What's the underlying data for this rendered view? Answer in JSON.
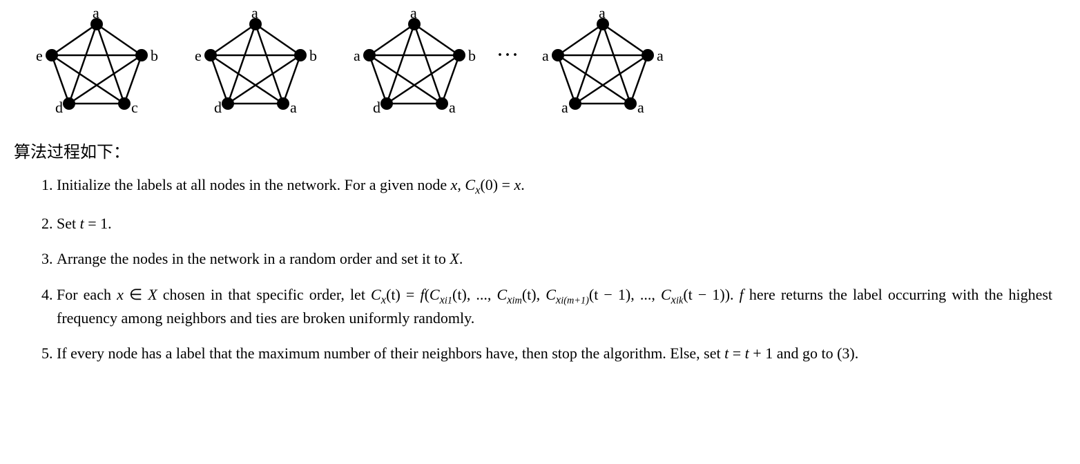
{
  "graphs": [
    {
      "labels": {
        "top": "a",
        "right": "b",
        "br": "c",
        "bl": "d",
        "left": "e"
      }
    },
    {
      "labels": {
        "top": "a",
        "right": "b",
        "br": "a",
        "bl": "d",
        "left": "e"
      }
    },
    {
      "labels": {
        "top": "a",
        "right": "b",
        "br": "a",
        "bl": "d",
        "left": "a"
      }
    },
    {
      "labels": {
        "top": "a",
        "right": "a",
        "br": "a",
        "bl": "a",
        "left": "a"
      }
    }
  ],
  "ellipsis": "···",
  "algo_heading": "算法过程如下：",
  "steps": {
    "s1": {
      "p1": "Initialize the labels at all nodes in the network. For a given node ",
      "x": "x",
      "p2": ", ",
      "formula_pre": "C",
      "formula_sub": "x",
      "formula_args": "(0) = ",
      "formula_rhs": "x",
      "p3": "."
    },
    "s2": {
      "p1": "Set ",
      "t": "t",
      "eq": " = 1."
    },
    "s3": {
      "p1": "Arrange the nodes in the network in a random order and set it to ",
      "X": "X",
      "p2": "."
    },
    "s4": {
      "p1": "For each ",
      "x": "x",
      "in": " ∈ ",
      "X": "X",
      "p2": " chosen in that specific order, let ",
      "Cx": "C",
      "Cx_sub": "x",
      "Cx_t": "(t)",
      "eq": " = ",
      "f": "f",
      "open": "(",
      "close": ")",
      "C1": "C",
      "C1_sub": "x",
      "C1_subsub": "i1",
      "C1_t": "(t)",
      "comma": ", ...,",
      "Cm": "C",
      "Cm_sub": "x",
      "Cm_subsub": "im",
      "Cm_t": "(t)",
      "comma2": ", ",
      "Cm1": "C",
      "Cm1_sub": "x",
      "Cm1_subsub": "i(m+1)",
      "Cm1_t": "(t − 1)",
      "comma3": ", ...,",
      "Ck": "C",
      "Ck_sub": "x",
      "Ck_subsub": "ik",
      "Ck_t": "(t − 1)",
      "p3": ". ",
      "f2": "f",
      "p4": " here returns the label occurring with the highest frequency among neighbors and ties are broken uniformly randomly."
    },
    "s5": {
      "p1": "If every node has a label that the maximum number of their neighbors have, then stop the algorithm. Else, set ",
      "t": "t",
      "eq": " = ",
      "t2": "t",
      "plus": " + 1",
      "p2": " and go to (3)."
    }
  }
}
